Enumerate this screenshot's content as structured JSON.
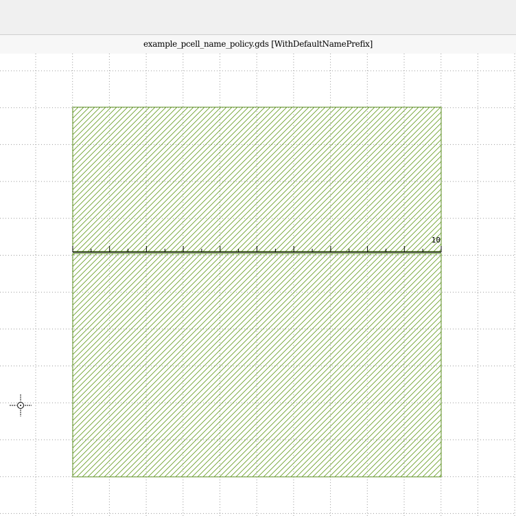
{
  "window": {
    "title": "example_pcell_name_policy.gds [WithDefaultNamePrefix]"
  },
  "layout": {
    "cell_fill_color": "#6aa02a",
    "cell_outline_color": "#5b8f1f",
    "grid_color": "#9a9a9a",
    "ruler": {
      "label": "10",
      "color": "#000000"
    },
    "cursor_icon": "crosshair-origin-icon"
  }
}
